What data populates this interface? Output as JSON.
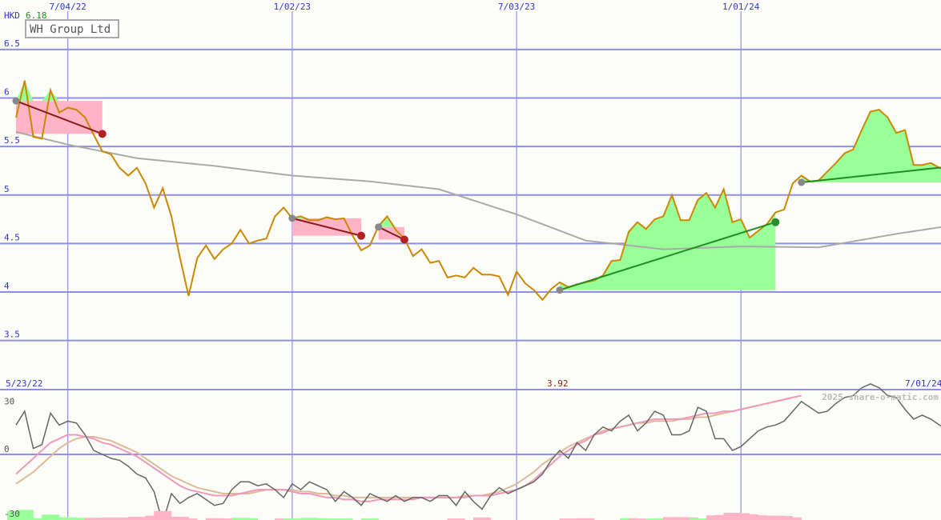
{
  "page": {
    "currency": "HKD",
    "top_value": "6.18",
    "date_start": "5/23/22",
    "date_end": "7/01/24",
    "min_label": "3.92",
    "watermark": "2025 share-o-matic.com"
  },
  "colors": {
    "background": "#fcfcf8",
    "grid": "#8f8fe8",
    "price_line": "#cc8800",
    "moving_avg": "#aaaaaa",
    "gain_fill": "#99ff99",
    "loss_fill": "#ffb3c6",
    "trend_up": "#228b22",
    "trend_down": "#8b1a1a",
    "dot_up": "#2e8b2e",
    "dot_down": "#b22222",
    "dot_start": "#888888",
    "osc_main": "#666666",
    "osc_pink": "#ee99bb",
    "osc_tan": "#ddbb99"
  },
  "chart_data": [
    {
      "type": "line",
      "title": "WH Group Ltd",
      "ylabel": "HKD",
      "ylim": [
        3.35,
        6.95
      ],
      "yticks": [
        "6.5",
        "6",
        "5.5",
        "5",
        "4.5",
        "4",
        "3.5"
      ],
      "xticks": [
        "7/04/22",
        "1/02/23",
        "7/03/23",
        "1/01/24"
      ],
      "series": [
        {
          "role": "price",
          "x": [
            "2022-05-23",
            "2022-05-30",
            "2022-06-06",
            "2022-06-13",
            "2022-06-20",
            "2022-06-27",
            "2022-07-04",
            "2022-07-11",
            "2022-07-18",
            "2022-07-25",
            "2022-08-01",
            "2022-08-08",
            "2022-08-15",
            "2022-08-22",
            "2022-08-29",
            "2022-09-05",
            "2022-09-12",
            "2022-09-19",
            "2022-09-26",
            "2022-10-03",
            "2022-10-10",
            "2022-10-17",
            "2022-10-24",
            "2022-10-31",
            "2022-11-07",
            "2022-11-14",
            "2022-11-21",
            "2022-11-28",
            "2022-12-05",
            "2022-12-12",
            "2022-12-19",
            "2022-12-26",
            "2023-01-02",
            "2023-01-09",
            "2023-01-16",
            "2023-01-23",
            "2023-01-30",
            "2023-02-06",
            "2023-02-13",
            "2023-02-20",
            "2023-02-27",
            "2023-03-06",
            "2023-03-13",
            "2023-03-20",
            "2023-03-27",
            "2023-04-03",
            "2023-04-10",
            "2023-04-17",
            "2023-04-24",
            "2023-05-01",
            "2023-05-08",
            "2023-05-15",
            "2023-05-22",
            "2023-05-29",
            "2023-06-05",
            "2023-06-12",
            "2023-06-19",
            "2023-06-26",
            "2023-07-03",
            "2023-07-10",
            "2023-07-17",
            "2023-07-24",
            "2023-07-31",
            "2023-08-07",
            "2023-08-14",
            "2023-08-21",
            "2023-08-28",
            "2023-09-04",
            "2023-09-11",
            "2023-09-18",
            "2023-09-25",
            "2023-10-02",
            "2023-10-09",
            "2023-10-16",
            "2023-10-23",
            "2023-10-30",
            "2023-11-06",
            "2023-11-13",
            "2023-11-20",
            "2023-11-27",
            "2023-12-04",
            "2023-12-11",
            "2023-12-18",
            "2023-12-25",
            "2024-01-01",
            "2024-01-08",
            "2024-01-15",
            "2024-01-22",
            "2024-01-29",
            "2024-02-05",
            "2024-02-12",
            "2024-02-19",
            "2024-02-26",
            "2024-03-04",
            "2024-03-11",
            "2024-03-18",
            "2024-03-25",
            "2024-04-01",
            "2024-04-08",
            "2024-04-15",
            "2024-04-22",
            "2024-04-29",
            "2024-05-06",
            "2024-05-13",
            "2024-05-20",
            "2024-05-27",
            "2024-06-03",
            "2024-06-10",
            "2024-06-17",
            "2024-06-24",
            "2024-07-01",
            "2024-07-08"
          ],
          "y": [
            5.8,
            6.18,
            5.6,
            5.58,
            6.08,
            5.85,
            5.9,
            5.88,
            5.8,
            5.62,
            5.45,
            5.42,
            5.28,
            5.2,
            5.28,
            5.12,
            4.87,
            5.07,
            4.78,
            4.35,
            3.96,
            4.35,
            4.48,
            4.34,
            4.44,
            4.5,
            4.64,
            4.5,
            4.53,
            4.55,
            4.78,
            4.87,
            4.76,
            4.78,
            4.74,
            4.74,
            4.77,
            4.75,
            4.76,
            4.58,
            4.43,
            4.48,
            4.68,
            4.78,
            4.64,
            4.55,
            4.37,
            4.44,
            4.3,
            4.32,
            4.15,
            4.17,
            4.15,
            4.25,
            4.18,
            4.18,
            4.16,
            3.97,
            4.21,
            4.09,
            4.02,
            3.92,
            4.03,
            4.1,
            4.05,
            4.08,
            4.1,
            4.12,
            4.17,
            4.32,
            4.33,
            4.62,
            4.72,
            4.65,
            4.75,
            4.78,
            5.0,
            4.74,
            4.74,
            4.95,
            5.02,
            4.87,
            5.06,
            4.72,
            4.75,
            4.56,
            4.63,
            4.7,
            4.82,
            4.85,
            5.12,
            5.2,
            5.14,
            5.15,
            5.24,
            5.33,
            5.43,
            5.47,
            5.67,
            5.86,
            5.88,
            5.8,
            5.64,
            5.67,
            5.31,
            5.31,
            5.33,
            5.28,
            5.25,
            5.22,
            5.13,
            5.05
          ]
        },
        {
          "role": "moving-average",
          "x": [
            "2022-05-23",
            "2022-07-04",
            "2022-08-29",
            "2022-10-31",
            "2023-01-02",
            "2023-03-06",
            "2023-05-01",
            "2023-07-03",
            "2023-08-28",
            "2023-10-30",
            "2024-01-01",
            "2024-03-04",
            "2024-05-06",
            "2024-07-08"
          ],
          "y": [
            5.65,
            5.52,
            5.38,
            5.3,
            5.2,
            5.14,
            5.06,
            4.8,
            4.53,
            4.44,
            4.47,
            4.46,
            4.6,
            4.72
          ]
        }
      ],
      "trades": [
        {
          "start": "2022-05-23",
          "end": "2022-08-01",
          "start_price": 5.97,
          "end_price": 5.63,
          "result": "loss"
        },
        {
          "start": "2023-01-02",
          "end": "2023-02-27",
          "start_price": 4.76,
          "end_price": 4.58,
          "result": "loss"
        },
        {
          "start": "2023-03-13",
          "end": "2023-04-03",
          "start_price": 4.67,
          "end_price": 4.54,
          "result": "loss"
        },
        {
          "start": "2023-08-07",
          "end": "2024-01-29",
          "start_price": 4.02,
          "end_price": 4.72,
          "result": "gain"
        },
        {
          "start": "2024-02-19",
          "end": "2024-07-01",
          "start_price": 5.13,
          "end_price": 5.31,
          "result": "gain"
        }
      ]
    },
    {
      "type": "line",
      "ylabel": "",
      "ylim": [
        -30,
        30
      ],
      "yticks": [
        "30",
        "0",
        "-30"
      ],
      "series": [
        {
          "role": "oscillator",
          "y": [
            15,
            22,
            3,
            5,
            21,
            15,
            17,
            16,
            10,
            2,
            0,
            -2,
            -3,
            -6,
            -10,
            -12,
            -19,
            -35,
            -20,
            -25,
            -22,
            -20,
            -23,
            -26,
            -25,
            -18,
            -14,
            -14,
            -16,
            -15,
            -18,
            -22,
            -15,
            -18,
            -14,
            -16,
            -18,
            -24,
            -19,
            -22,
            -26,
            -20,
            -22,
            -24,
            -21,
            -24,
            -22,
            -22,
            -24,
            -21,
            -21,
            -26,
            -19,
            -24,
            -28,
            -21,
            -17,
            -20,
            -18,
            -16,
            -14,
            -10,
            -3,
            2,
            -2,
            6,
            2,
            10,
            14,
            12,
            17,
            20,
            12,
            16,
            22,
            20,
            10,
            10,
            12,
            24,
            22,
            8,
            8,
            2,
            4,
            8,
            12,
            14,
            15,
            17,
            22,
            27,
            24,
            21,
            22,
            26,
            29,
            30,
            34,
            36,
            34,
            30,
            29,
            23,
            18,
            20,
            18,
            15,
            12,
            10,
            9
          ]
        },
        {
          "role": "signal-pink",
          "y": [
            -10,
            -6,
            -2,
            2,
            6,
            8,
            10,
            10,
            9,
            8,
            6,
            5,
            3,
            1,
            -1,
            -4,
            -7,
            -10,
            -13,
            -16,
            -18,
            -19,
            -20,
            -21,
            -21,
            -21,
            -20,
            -19,
            -18,
            -18,
            -18,
            -18,
            -19,
            -20,
            -20,
            -21,
            -22,
            -22,
            -23,
            -23,
            -24,
            -24,
            -23,
            -23,
            -23,
            -23,
            -23,
            -22,
            -22,
            -22,
            -22,
            -22,
            -22,
            -21,
            -21,
            -21,
            -20,
            -19,
            -18,
            -16,
            -13,
            -9,
            -5,
            -1,
            2,
            5,
            7,
            10,
            11,
            13,
            14,
            15,
            16,
            17,
            18,
            18,
            18,
            18,
            19,
            20,
            21,
            21,
            22,
            22,
            23,
            24,
            25,
            26,
            27,
            28,
            29,
            30
          ]
        },
        {
          "role": "signal-tan",
          "y": [
            -15,
            -12,
            -9,
            -5,
            -1,
            3,
            6,
            8,
            9,
            9,
            8,
            7,
            5,
            3,
            1,
            -2,
            -5,
            -8,
            -11,
            -13,
            -15,
            -17,
            -18,
            -19,
            -20,
            -20,
            -20,
            -20,
            -19,
            -18,
            -18,
            -18,
            -18,
            -19,
            -19,
            -20,
            -20,
            -21,
            -21,
            -22,
            -22,
            -22,
            -22,
            -22,
            -22,
            -22,
            -22,
            -22,
            -22,
            -22,
            -22,
            -22,
            -21,
            -21,
            -21,
            -20,
            -19,
            -17,
            -15,
            -12,
            -9,
            -5,
            -2,
            1,
            4,
            6,
            8,
            10,
            12,
            13,
            14,
            15,
            16,
            16,
            17,
            17,
            17,
            18,
            18,
            19,
            19,
            20,
            21,
            22,
            23,
            24,
            25,
            26,
            27,
            28,
            29
          ]
        }
      ]
    }
  ]
}
